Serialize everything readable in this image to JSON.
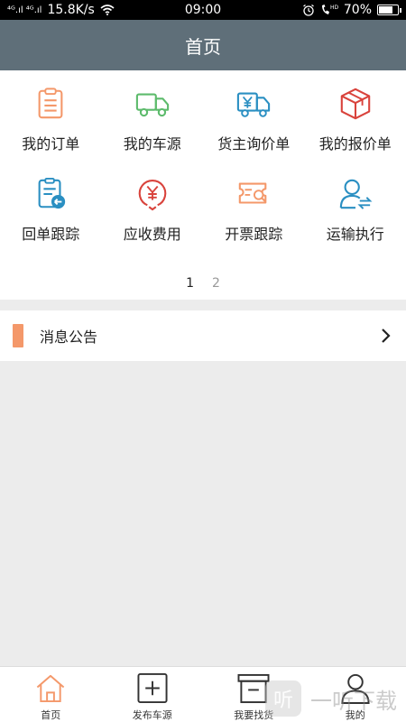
{
  "status_bar": {
    "signal": "⁴ᴳ.ıl ⁴ᴳ.ıl",
    "speed": "15.8K/s",
    "time": "09:00",
    "battery": "70%"
  },
  "header": {
    "title": "首页"
  },
  "grid": {
    "items": [
      {
        "label": "我的订单",
        "icon": "clipboard-list-icon"
      },
      {
        "label": "我的车源",
        "icon": "truck-icon"
      },
      {
        "label": "货主询价单",
        "icon": "yen-truck-icon"
      },
      {
        "label": "我的报价单",
        "icon": "package-box-icon"
      },
      {
        "label": "回单跟踪",
        "icon": "receipt-return-icon"
      },
      {
        "label": "应收费用",
        "icon": "yen-circle-icon"
      },
      {
        "label": "开票跟踪",
        "icon": "invoice-search-icon"
      },
      {
        "label": "运输执行",
        "icon": "user-transfer-icon"
      }
    ]
  },
  "pager": {
    "page1": "1",
    "page2": "2"
  },
  "notice": {
    "label": "消息公告"
  },
  "tabbar": {
    "tabs": [
      {
        "label": "首页",
        "icon": "home-icon"
      },
      {
        "label": "发布车源",
        "icon": "plus-square-icon"
      },
      {
        "label": "我要找货",
        "icon": "box-minus-icon"
      },
      {
        "label": "我的",
        "icon": "person-icon"
      }
    ]
  },
  "watermark": {
    "mark": "听",
    "text": "一听下载"
  },
  "colors": {
    "header_bg": "#5f6f79",
    "accent_orange": "#f4986a",
    "accent_green": "#5dbb6c",
    "accent_blue": "#2a8fc2",
    "accent_red": "#d9433c"
  }
}
